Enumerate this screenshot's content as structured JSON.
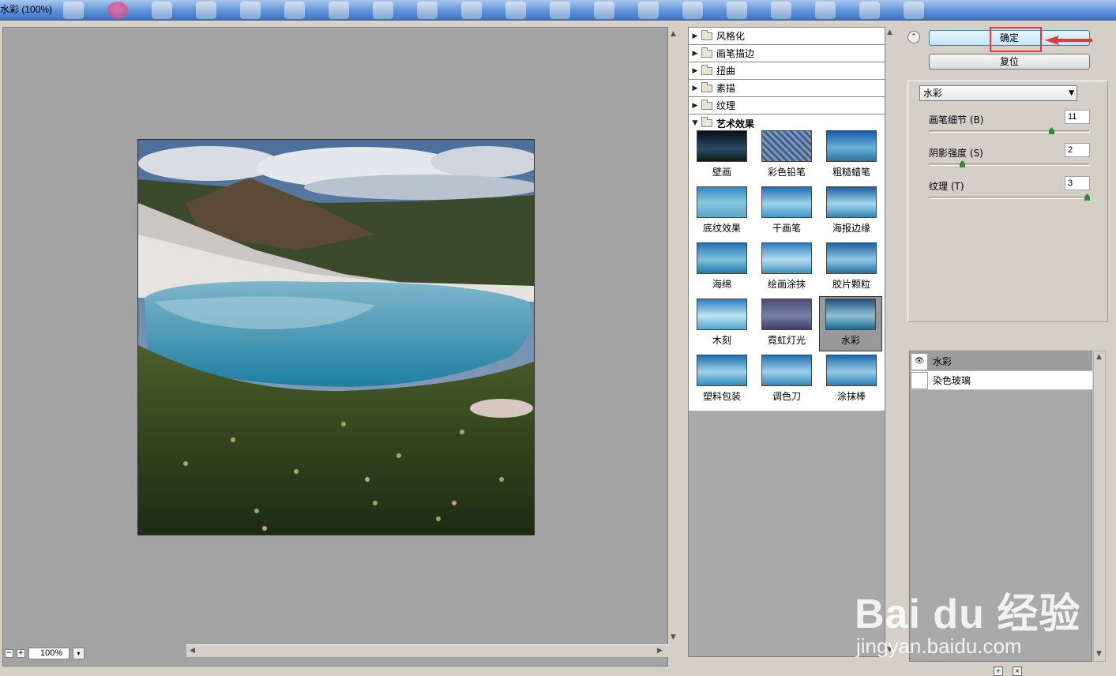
{
  "window": {
    "title": "水彩 (100%)"
  },
  "preview": {
    "zoom": "100%",
    "zoom_out": "−",
    "zoom_in": "+",
    "zoom_menu": "▾"
  },
  "filter_categories": [
    {
      "label": "风格化",
      "expanded": false
    },
    {
      "label": "画笔描边",
      "expanded": false
    },
    {
      "label": "扭曲",
      "expanded": false
    },
    {
      "label": "素描",
      "expanded": false
    },
    {
      "label": "纹理",
      "expanded": false
    },
    {
      "label": "艺术效果",
      "expanded": true
    }
  ],
  "art_filters": [
    {
      "label": "壁画"
    },
    {
      "label": "彩色铅笔"
    },
    {
      "label": "粗糙蜡笔"
    },
    {
      "label": "底纹效果"
    },
    {
      "label": "干画笔"
    },
    {
      "label": "海报边缘"
    },
    {
      "label": "海绵"
    },
    {
      "label": "绘画涂抹"
    },
    {
      "label": "胶片颗粒"
    },
    {
      "label": "木刻"
    },
    {
      "label": "霓虹灯光"
    },
    {
      "label": "水彩",
      "selected": true
    },
    {
      "label": "塑料包装"
    },
    {
      "label": "调色刀"
    },
    {
      "label": "涂抹棒"
    }
  ],
  "buttons": {
    "ok": "确定",
    "reset": "复位"
  },
  "filter_select": {
    "value": "水彩"
  },
  "params": [
    {
      "label": "画笔细节 (B)",
      "value": "11",
      "min": 1,
      "max": 14
    },
    {
      "label": "阴影强度 (S)",
      "value": "2",
      "min": 0,
      "max": 10
    },
    {
      "label": "纹理 (T)",
      "value": "3",
      "min": 1,
      "max": 3
    }
  ],
  "effect_layers": [
    {
      "label": "水彩",
      "visible": true,
      "active": true
    },
    {
      "label": "染色玻璃",
      "visible": false,
      "active": false
    }
  ],
  "watermark": {
    "brand": "Bai du 经验",
    "url": "jingyan.baidu.com"
  },
  "colors": {
    "highlight": "#e53935",
    "preview_bg": "#a3a3a3",
    "accent": "#3c7fb1"
  }
}
